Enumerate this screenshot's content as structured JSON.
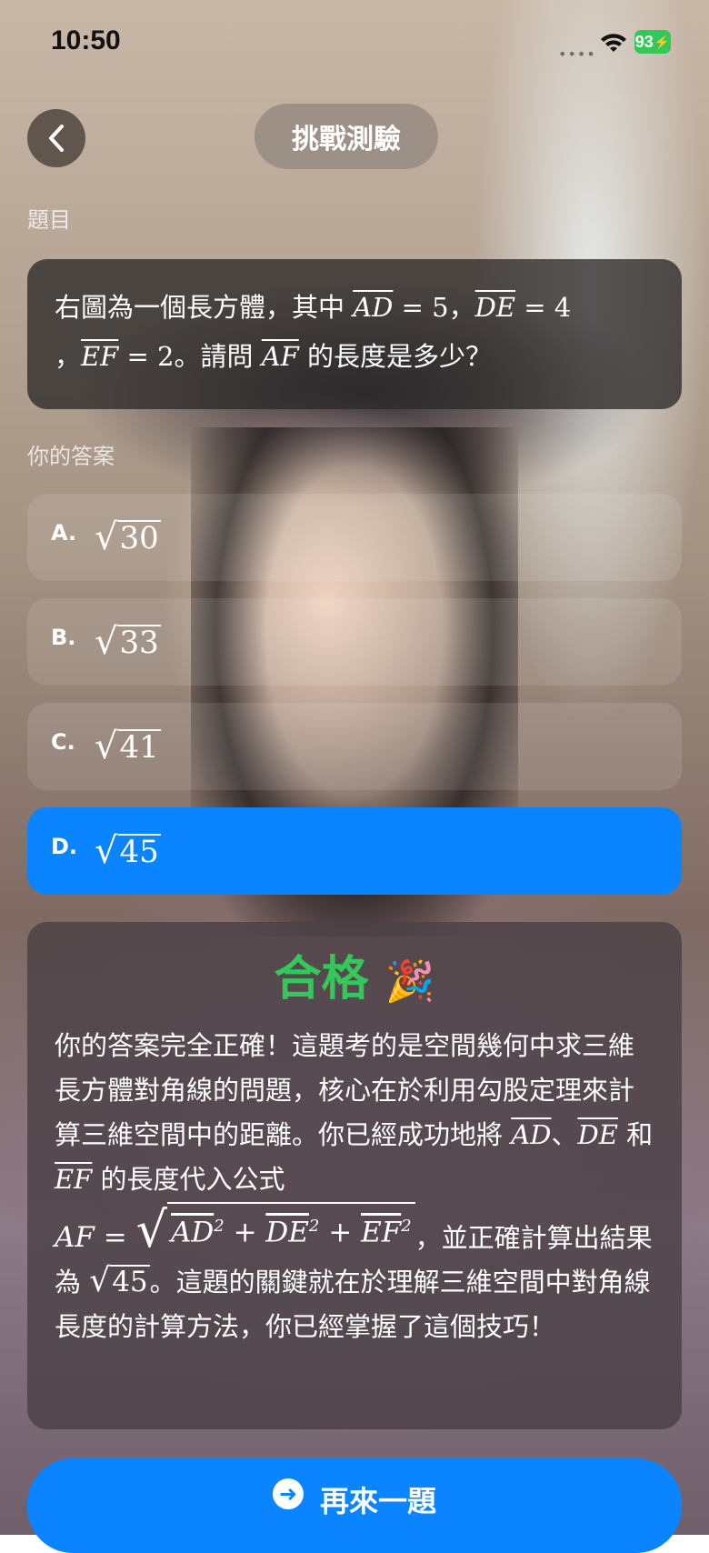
{
  "status_bar": {
    "time": "10:50",
    "battery": "93"
  },
  "header": {
    "title": "挑戰測驗"
  },
  "question": {
    "section_label": "題目",
    "text_part1": "右圖為一個長方體，其中",
    "seg_ad": "AD",
    "eq_5": "= 5",
    "sep": "，",
    "seg_de": "DE",
    "eq_4": "= 4",
    "sep2": "，",
    "seg_ef": "EF",
    "eq_2": "= 2",
    "text_part2": "。請問",
    "seg_af": "AF",
    "text_part3": "的長度是多少？"
  },
  "answers": {
    "section_label": "你的答案",
    "options": [
      {
        "letter": "A.",
        "value": "30"
      },
      {
        "letter": "B.",
        "value": "33"
      },
      {
        "letter": "C.",
        "value": "41"
      },
      {
        "letter": "D.",
        "value": "45"
      }
    ],
    "selected_index": 3
  },
  "result": {
    "title": "合格",
    "emoji": "🎉",
    "p1": "你的答案完全正確！這題考的是空間幾何中求三維長方體對角線的問題，核心在於利用勾股定理來計算三維空間中的距離。你已經成功地將",
    "seg_ad": "AD",
    "dun": "、",
    "seg_de": "DE",
    "he": "和",
    "seg_ef": "EF",
    "p2": "的長度代入公式",
    "formula_lhs": "AF =",
    "formula_ad": "AD",
    "formula_de": "DE",
    "formula_ef": "EF",
    "exp": "2",
    "plus": "+",
    "p3": "，並正確計算出結果為",
    "result_value": "45",
    "p4": "。這題的關鍵就在於理解三維空間中對角線長度的計算方法，你已經掌握了這個技巧！"
  },
  "next_button": {
    "label": "再來一題"
  }
}
